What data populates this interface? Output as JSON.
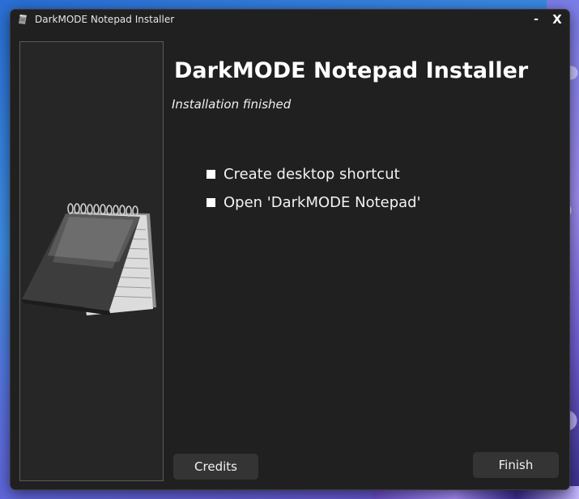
{
  "window": {
    "title": "DarkMODE Notepad Installer",
    "minimize_label": "-",
    "close_label": "X"
  },
  "main": {
    "title": "DarkMODE Notepad Installer",
    "subtitle": "Installation finished"
  },
  "options": [
    {
      "label": "Create desktop shortcut"
    },
    {
      "label": "Open 'DarkMODE Notepad'"
    }
  ],
  "buttons": {
    "credits_label": "Credits",
    "finish_label": "Finish"
  },
  "icons": {
    "app_icon": "notepad-icon",
    "side_art": "notepad-illustration"
  },
  "colors": {
    "window_bg": "#202020",
    "button_bg": "#343434",
    "text": "#ffffff"
  }
}
